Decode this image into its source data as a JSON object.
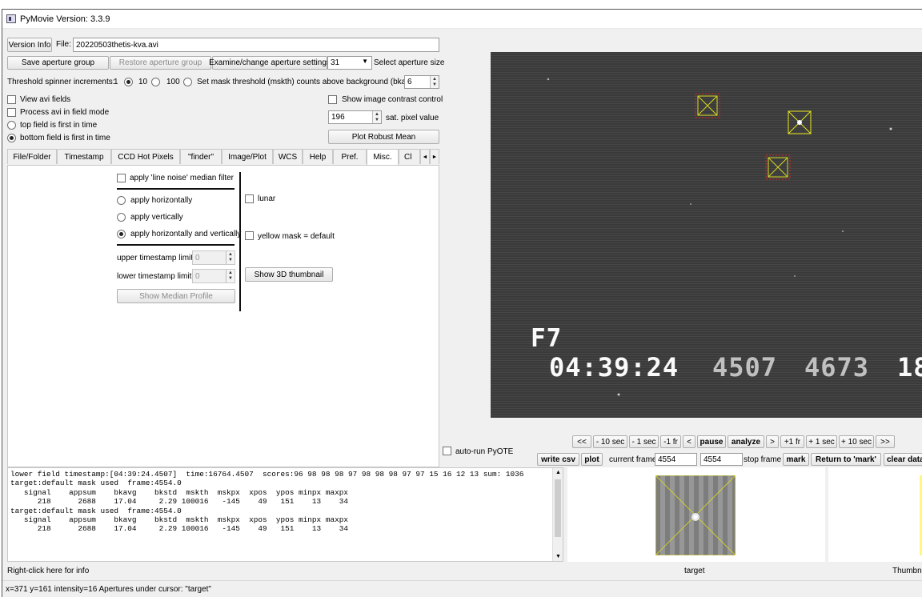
{
  "window": {
    "title": "PyMovie  Version: 3.3.9"
  },
  "top": {
    "version_info": "Version Info",
    "file_label": "File:",
    "file_value": "20220503thetis-kva.avi",
    "save_aperture_group": "Save aperture group",
    "restore_aperture_group": "Restore aperture group",
    "examine_change": "Examine/change aperture settings",
    "aperture_size": "31",
    "select_aperture_size": "Select aperture size",
    "threshold_label": "Threshold spinner increments:",
    "inc_1": "1",
    "inc_10": "10",
    "inc_100": "100",
    "mask_threshold_label": "Set mask threshold (mskth) counts above background (bkavg)",
    "mask_threshold_value": "6",
    "view_avi_fields": "View avi fields",
    "process_avi": "Process avi in field mode",
    "top_field_first": "top field is first in time",
    "bottom_field_first": "bottom field is first in time",
    "show_contrast": "Show image contrast control",
    "sat_value": "196",
    "sat_label": "sat. pixel value",
    "plot_robust_mean": "Plot Robust Mean"
  },
  "tabs": [
    "File/Folder",
    "Timestamp",
    "CCD Hot Pixels",
    "\"finder\"",
    "Image/Plot",
    "WCS",
    "Help",
    "Pref.",
    "Misc.",
    "Cl"
  ],
  "misc": {
    "line_noise": "apply 'line noise' median filter",
    "apply_h": "apply horizontally",
    "apply_v": "apply vertically",
    "apply_hv": "apply horizontally and vertically",
    "upper_ts": "upper timestamp limit",
    "upper_ts_value": "0",
    "lower_ts": "lower timestamp limit",
    "lower_ts_value": "0",
    "show_median": "Show Median Profile",
    "lunar": "lunar",
    "yellow_mask": "yellow mask = default",
    "show_3d": "Show 3D thumbnail"
  },
  "video": {
    "field_label": "F7",
    "time": "04:39:24",
    "num1": "4507",
    "num2": "4673",
    "num3": "18"
  },
  "controls": {
    "auto_run": "auto-run PyOTE",
    "nav": [
      "<<",
      "- 10 sec",
      "- 1 sec",
      "-1 fr",
      "<",
      "pause",
      "analyze",
      ">",
      "+1 fr",
      "+ 1 sec",
      "+ 10 sec",
      ">>"
    ],
    "write_csv": "write csv",
    "plot": "plot",
    "current_frame_label": "current frame",
    "current_frame": "4554",
    "stop_frame_value": "4554",
    "stop_frame_label": "stop frame",
    "mark": "mark",
    "return_to_mark": "Return to 'mark'",
    "clear_data": "clear data"
  },
  "log": {
    "lines": [
      "lower field timestamp:[04:39:24.4507]  time:16764.4507  scores:96 98 98 98 97 98 98 98 97 97 15 16 12 13 sum: 1036",
      "",
      "target:default mask used  frame:4554.0",
      "   signal    appsum    bkavg    bkstd  mskth  mskpx  xpos  ypos minpx maxpx",
      "      218      2688    17.04     2.29 100016   -145    49   151    13    34",
      "",
      "target:default mask used  frame:4554.0",
      "   signal    appsum    bkavg    bkstd  mskth  mskpx  xpos  ypos minpx maxpx",
      "      218      2688    17.04     2.29 100016   -145    49   151    13    34"
    ]
  },
  "thumb": {
    "target_label": "target",
    "thumbnail_label": "Thumbna"
  },
  "status": {
    "right_click": "Right-click here for info",
    "cursor": "x=371 y=161 intensity=16   Apertures under cursor: \"target\""
  }
}
